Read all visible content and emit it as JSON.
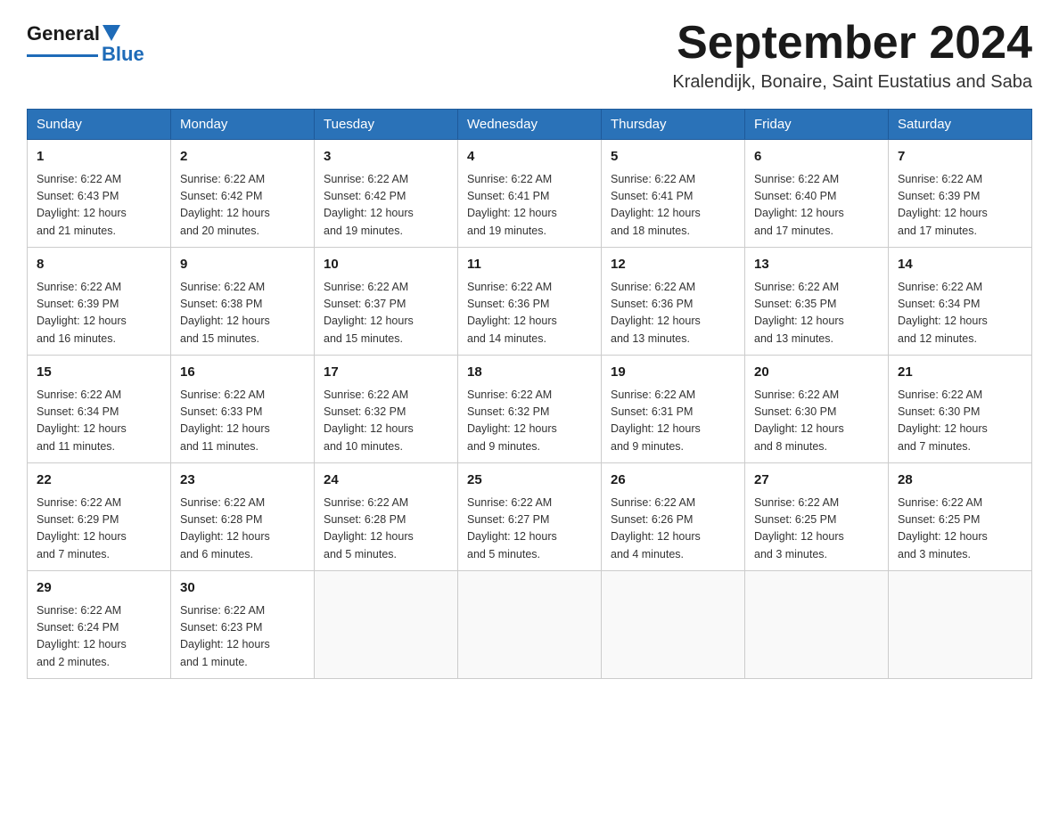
{
  "header": {
    "logo": {
      "part1": "General",
      "part2": "Blue"
    },
    "month_title": "September 2024",
    "location": "Kralendijk, Bonaire, Saint Eustatius and Saba"
  },
  "days_of_week": [
    "Sunday",
    "Monday",
    "Tuesday",
    "Wednesday",
    "Thursday",
    "Friday",
    "Saturday"
  ],
  "weeks": [
    [
      {
        "day": 1,
        "sunrise": "6:22 AM",
        "sunset": "6:43 PM",
        "daylight": "12 hours and 21 minutes."
      },
      {
        "day": 2,
        "sunrise": "6:22 AM",
        "sunset": "6:42 PM",
        "daylight": "12 hours and 20 minutes."
      },
      {
        "day": 3,
        "sunrise": "6:22 AM",
        "sunset": "6:42 PM",
        "daylight": "12 hours and 19 minutes."
      },
      {
        "day": 4,
        "sunrise": "6:22 AM",
        "sunset": "6:41 PM",
        "daylight": "12 hours and 19 minutes."
      },
      {
        "day": 5,
        "sunrise": "6:22 AM",
        "sunset": "6:41 PM",
        "daylight": "12 hours and 18 minutes."
      },
      {
        "day": 6,
        "sunrise": "6:22 AM",
        "sunset": "6:40 PM",
        "daylight": "12 hours and 17 minutes."
      },
      {
        "day": 7,
        "sunrise": "6:22 AM",
        "sunset": "6:39 PM",
        "daylight": "12 hours and 17 minutes."
      }
    ],
    [
      {
        "day": 8,
        "sunrise": "6:22 AM",
        "sunset": "6:39 PM",
        "daylight": "12 hours and 16 minutes."
      },
      {
        "day": 9,
        "sunrise": "6:22 AM",
        "sunset": "6:38 PM",
        "daylight": "12 hours and 15 minutes."
      },
      {
        "day": 10,
        "sunrise": "6:22 AM",
        "sunset": "6:37 PM",
        "daylight": "12 hours and 15 minutes."
      },
      {
        "day": 11,
        "sunrise": "6:22 AM",
        "sunset": "6:36 PM",
        "daylight": "12 hours and 14 minutes."
      },
      {
        "day": 12,
        "sunrise": "6:22 AM",
        "sunset": "6:36 PM",
        "daylight": "12 hours and 13 minutes."
      },
      {
        "day": 13,
        "sunrise": "6:22 AM",
        "sunset": "6:35 PM",
        "daylight": "12 hours and 13 minutes."
      },
      {
        "day": 14,
        "sunrise": "6:22 AM",
        "sunset": "6:34 PM",
        "daylight": "12 hours and 12 minutes."
      }
    ],
    [
      {
        "day": 15,
        "sunrise": "6:22 AM",
        "sunset": "6:34 PM",
        "daylight": "12 hours and 11 minutes."
      },
      {
        "day": 16,
        "sunrise": "6:22 AM",
        "sunset": "6:33 PM",
        "daylight": "12 hours and 11 minutes."
      },
      {
        "day": 17,
        "sunrise": "6:22 AM",
        "sunset": "6:32 PM",
        "daylight": "12 hours and 10 minutes."
      },
      {
        "day": 18,
        "sunrise": "6:22 AM",
        "sunset": "6:32 PM",
        "daylight": "12 hours and 9 minutes."
      },
      {
        "day": 19,
        "sunrise": "6:22 AM",
        "sunset": "6:31 PM",
        "daylight": "12 hours and 9 minutes."
      },
      {
        "day": 20,
        "sunrise": "6:22 AM",
        "sunset": "6:30 PM",
        "daylight": "12 hours and 8 minutes."
      },
      {
        "day": 21,
        "sunrise": "6:22 AM",
        "sunset": "6:30 PM",
        "daylight": "12 hours and 7 minutes."
      }
    ],
    [
      {
        "day": 22,
        "sunrise": "6:22 AM",
        "sunset": "6:29 PM",
        "daylight": "12 hours and 7 minutes."
      },
      {
        "day": 23,
        "sunrise": "6:22 AM",
        "sunset": "6:28 PM",
        "daylight": "12 hours and 6 minutes."
      },
      {
        "day": 24,
        "sunrise": "6:22 AM",
        "sunset": "6:28 PM",
        "daylight": "12 hours and 5 minutes."
      },
      {
        "day": 25,
        "sunrise": "6:22 AM",
        "sunset": "6:27 PM",
        "daylight": "12 hours and 5 minutes."
      },
      {
        "day": 26,
        "sunrise": "6:22 AM",
        "sunset": "6:26 PM",
        "daylight": "12 hours and 4 minutes."
      },
      {
        "day": 27,
        "sunrise": "6:22 AM",
        "sunset": "6:25 PM",
        "daylight": "12 hours and 3 minutes."
      },
      {
        "day": 28,
        "sunrise": "6:22 AM",
        "sunset": "6:25 PM",
        "daylight": "12 hours and 3 minutes."
      }
    ],
    [
      {
        "day": 29,
        "sunrise": "6:22 AM",
        "sunset": "6:24 PM",
        "daylight": "12 hours and 2 minutes."
      },
      {
        "day": 30,
        "sunrise": "6:22 AM",
        "sunset": "6:23 PM",
        "daylight": "12 hours and 1 minute."
      },
      null,
      null,
      null,
      null,
      null
    ]
  ]
}
